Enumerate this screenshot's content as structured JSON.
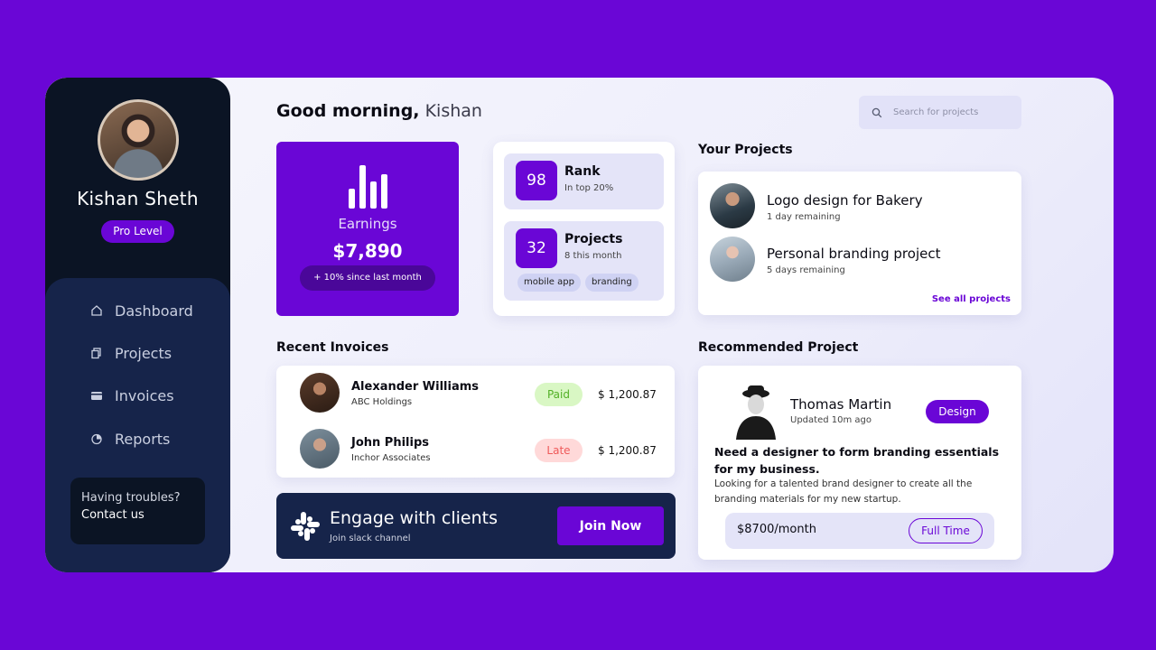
{
  "profile": {
    "name": "Kishan Sheth",
    "level": "Pro Level"
  },
  "nav": [
    {
      "label": "Dashboard",
      "icon": "home-icon"
    },
    {
      "label": "Projects",
      "icon": "copy-icon"
    },
    {
      "label": "Invoices",
      "icon": "wallet-icon"
    },
    {
      "label": "Reports",
      "icon": "pie-chart-icon"
    }
  ],
  "help": {
    "question": "Having troubles?",
    "link": "Contact us"
  },
  "header": {
    "greeting": "Good morning,",
    "name": "Kishan"
  },
  "search": {
    "placeholder": "Search for projects"
  },
  "earnings": {
    "label": "Earnings",
    "amount": "$7,890",
    "change": "+ 10% since last month"
  },
  "stats": {
    "rank": {
      "value": "98",
      "title": "Rank",
      "sub": "In top 20%"
    },
    "projects": {
      "value": "32",
      "title": "Projects",
      "sub": "8 this month",
      "tags": [
        "mobile app",
        "branding"
      ]
    }
  },
  "your_projects": {
    "title": "Your Projects",
    "items": [
      {
        "title": "Logo design for Bakery",
        "sub": "1 day remaining"
      },
      {
        "title": "Personal branding project",
        "sub": "5 days remaining"
      }
    ],
    "see_all": "See all projects"
  },
  "invoices": {
    "title": "Recent Invoices",
    "rows": [
      {
        "name": "Alexander Williams",
        "company": "ABC Holdings",
        "status": "Paid",
        "amount": "$ 1,200.87"
      },
      {
        "name": "John Philips",
        "company": "Inchor Associates",
        "status": "Late",
        "amount": "$ 1,200.87"
      }
    ]
  },
  "engage": {
    "title": "Engage with clients",
    "sub": "Join slack channel",
    "button": "Join Now"
  },
  "recommended": {
    "title": "Recommended Project",
    "name": "Thomas Martin",
    "updated": "Updated 10m ago",
    "badge": "Design",
    "headline": "Need a designer to form branding essentials for my business.",
    "description": "Looking for a talented brand designer to create all the branding materials for my new startup.",
    "salary": "$8700/month",
    "type": "Full Time"
  },
  "colors": {
    "accent": "#6a06d6",
    "sidebar_dark": "#0b1424",
    "sidebar_navy": "#16244a",
    "paid_bg": "#d9f7c4",
    "paid_text": "#52b026",
    "late_bg": "#ffd9d9",
    "late_text": "#ef5a5a"
  }
}
